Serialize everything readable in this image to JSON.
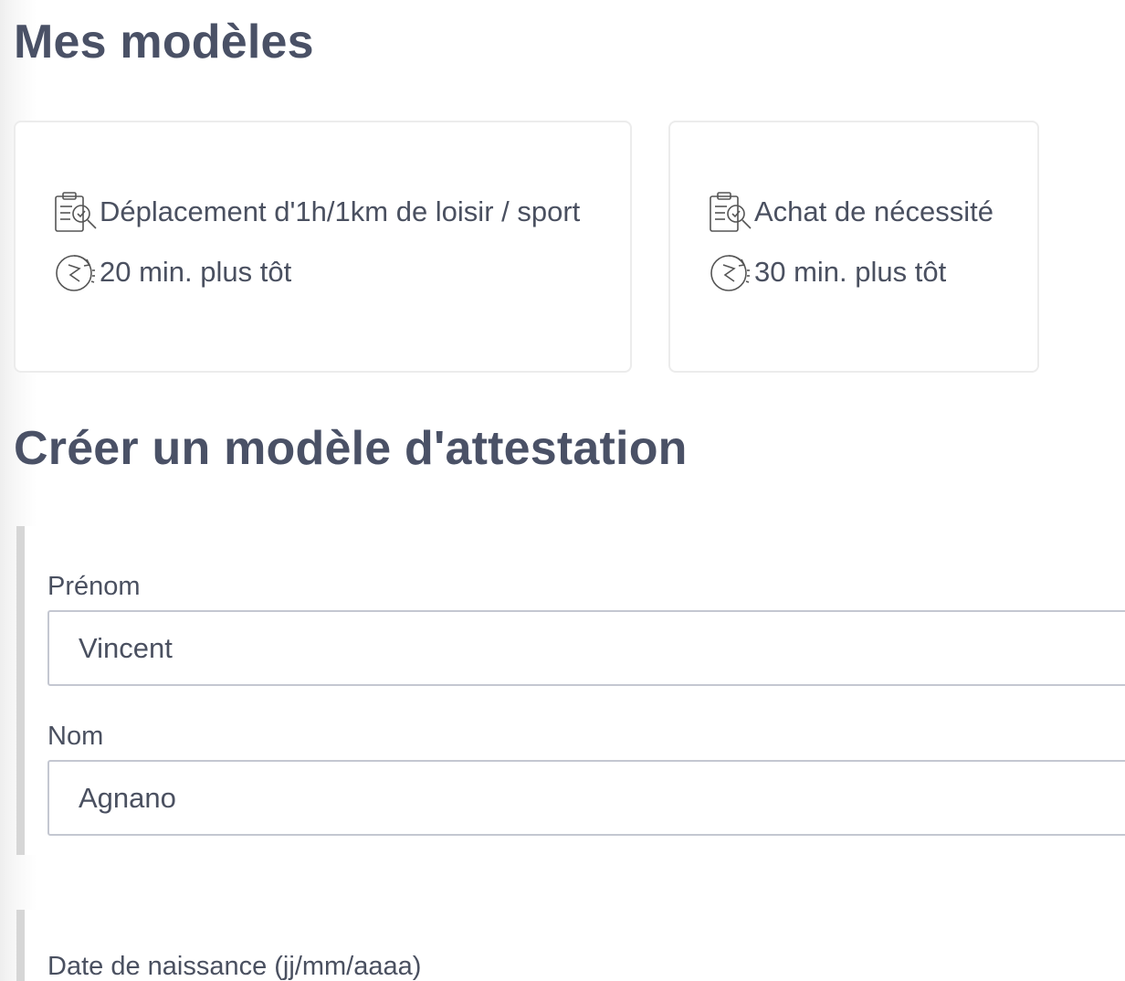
{
  "models": {
    "title": "Mes modèles",
    "cards": [
      {
        "reason": "Déplacement d'1h/1km de loisir / sport",
        "delay": "20 min. plus tôt",
        "reason_icon": "clipboard-check-icon",
        "delay_icon": "stopwatch-rewind-icon"
      },
      {
        "reason": "Achat de nécessité",
        "delay": "30 min. plus tôt",
        "reason_icon": "clipboard-check-icon",
        "delay_icon": "stopwatch-rewind-icon"
      }
    ]
  },
  "create": {
    "title": "Créer un modèle d'attestation",
    "firstname": {
      "label": "Prénom",
      "value": "Vincent"
    },
    "lastname": {
      "label": "Nom",
      "value": "Agnano"
    },
    "birthdate": {
      "label": "Date de naissance (jj/mm/aaaa)"
    }
  },
  "colors": {
    "heading": "#4a5166",
    "text": "#4a5060",
    "card_border": "#ececec",
    "section_bar": "#d6d6d6",
    "input_border": "#c4c7d1"
  }
}
